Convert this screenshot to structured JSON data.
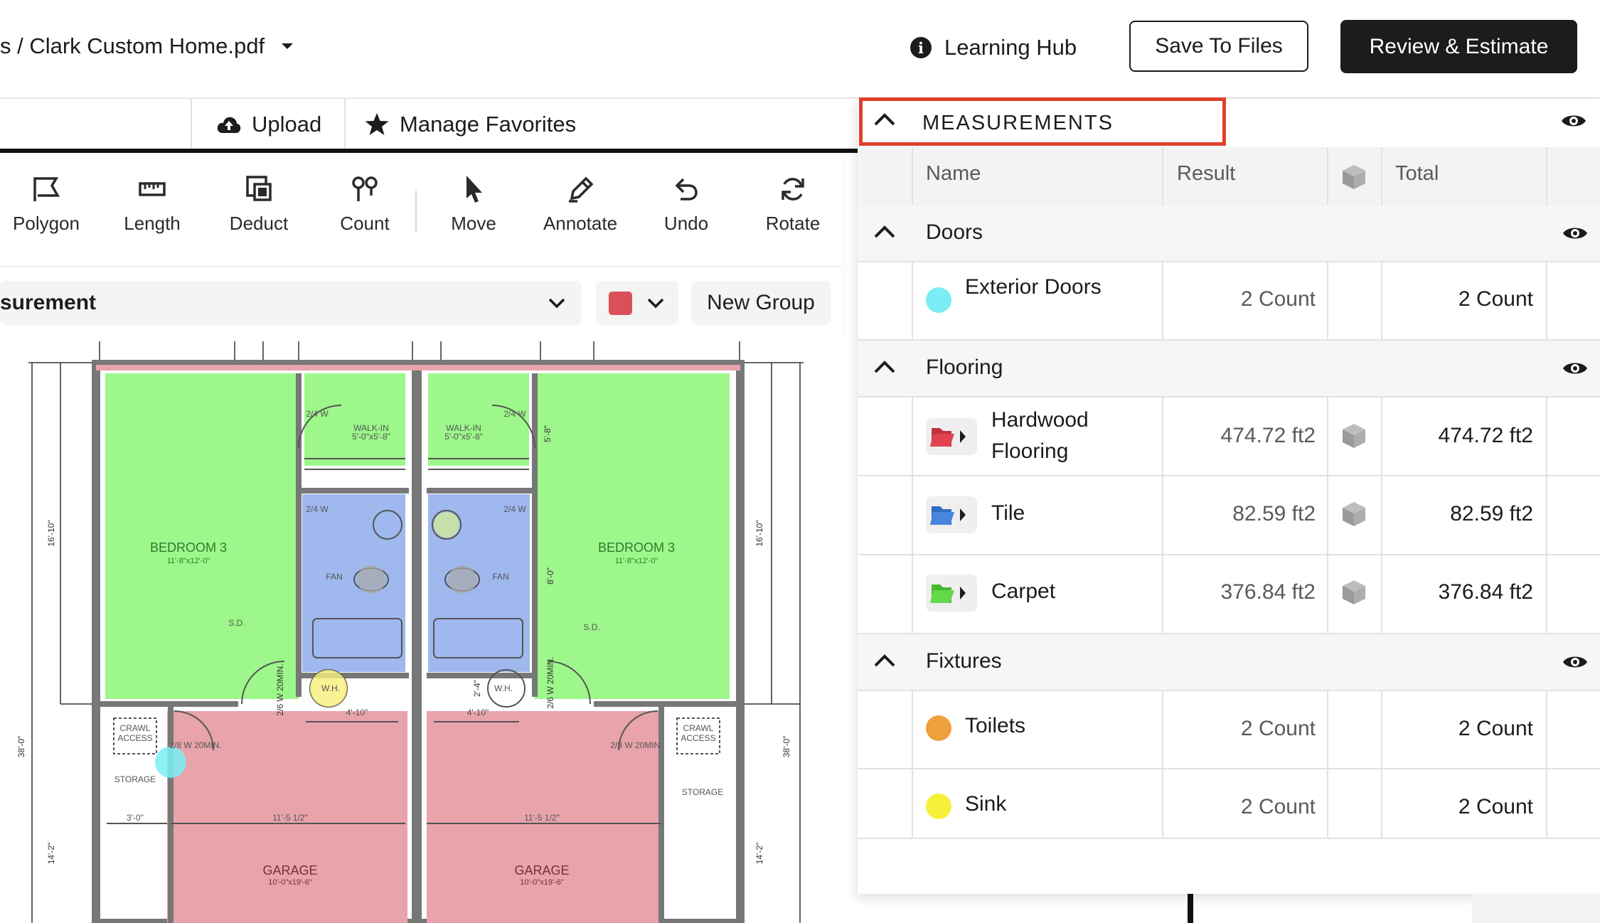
{
  "header": {
    "breadcrumb": "s / Clark Custom Home.pdf",
    "learning_hub": "Learning Hub",
    "save_to_files": "Save To Files",
    "review_estimate": "Review & Estimate"
  },
  "subbar": {
    "upload": "Upload",
    "manage_favorites": "Manage Favorites"
  },
  "tools": [
    {
      "label": "Polygon",
      "icon": "polygon-icon"
    },
    {
      "label": "Length",
      "icon": "ruler-icon"
    },
    {
      "label": "Deduct",
      "icon": "deduct-icon"
    },
    {
      "label": "Count",
      "icon": "count-icon"
    },
    {
      "label": "Move",
      "icon": "cursor-icon"
    },
    {
      "label": "Annotate",
      "icon": "pen-icon"
    },
    {
      "label": "Undo",
      "icon": "undo-icon"
    },
    {
      "label": "Rotate",
      "icon": "rotate-icon"
    }
  ],
  "toolbar2": {
    "measurement_select": "surement",
    "color": "#d9505a",
    "new_group": "New Group"
  },
  "plan": {
    "bedroom_left": "BEDROOM 3",
    "bedroom_left_dim": "11'-8\"x12'-0\"",
    "bedroom_right": "BEDROOM 3",
    "bedroom_right_dim": "11'-8\"x12'-0\"",
    "walkin": "WALK-IN",
    "walkin_dim": "5'-0\"x5'-8\"",
    "door_24": "2/4 W",
    "fan": "FAN",
    "wh": "W.H.",
    "garage": "GARAGE",
    "garage_dim": "10'-0\"x19'-6\"",
    "crawl": "CRAWL",
    "access": "ACCESS",
    "storage": "STORAGE",
    "door_28": "2/8 W 20MIN.",
    "door_26": "2/6 W 20MIN.",
    "dim_4_10": "4'-10\"",
    "dim_3_0": "3'-0\"",
    "dim_11_5": "11'-5 1/2\"",
    "dim_16_10": "16'-10\"",
    "dim_38_0": "38'-0\"",
    "dim_14_2": "14'-2\"",
    "dim_5_8": "5'-8\"",
    "dim_8_0": "8'-0\"",
    "dim_2_4": "2'-4\"",
    "sd": "S.D."
  },
  "measurements": {
    "title": "MEASUREMENTS",
    "columns": {
      "name": "Name",
      "result": "Result",
      "total": "Total"
    },
    "groups": [
      {
        "name": "Doors",
        "items": [
          {
            "name": "Exterior Doors",
            "result": "2 Count",
            "total": "2 Count",
            "color": "#7aeef5"
          }
        ]
      },
      {
        "name": "Flooring",
        "items": [
          {
            "name_line1": "Hardwood",
            "name_line2": "Flooring",
            "result": "474.72 ft2",
            "total": "474.72 ft2",
            "color": "#e0434e"
          },
          {
            "name": "Tile",
            "result": "82.59 ft2",
            "total": "82.59 ft2",
            "color": "#4a86e0"
          },
          {
            "name": "Carpet",
            "result": "376.84 ft2",
            "total": "376.84 ft2",
            "color": "#63d94a"
          }
        ]
      },
      {
        "name": "Fixtures",
        "items": [
          {
            "name": "Toilets",
            "result": "2 Count",
            "total": "2 Count",
            "color": "#f0a03a"
          },
          {
            "name": "Sink",
            "result": "2 Count",
            "total": "2 Count",
            "color": "#f7f03a"
          }
        ]
      }
    ]
  }
}
